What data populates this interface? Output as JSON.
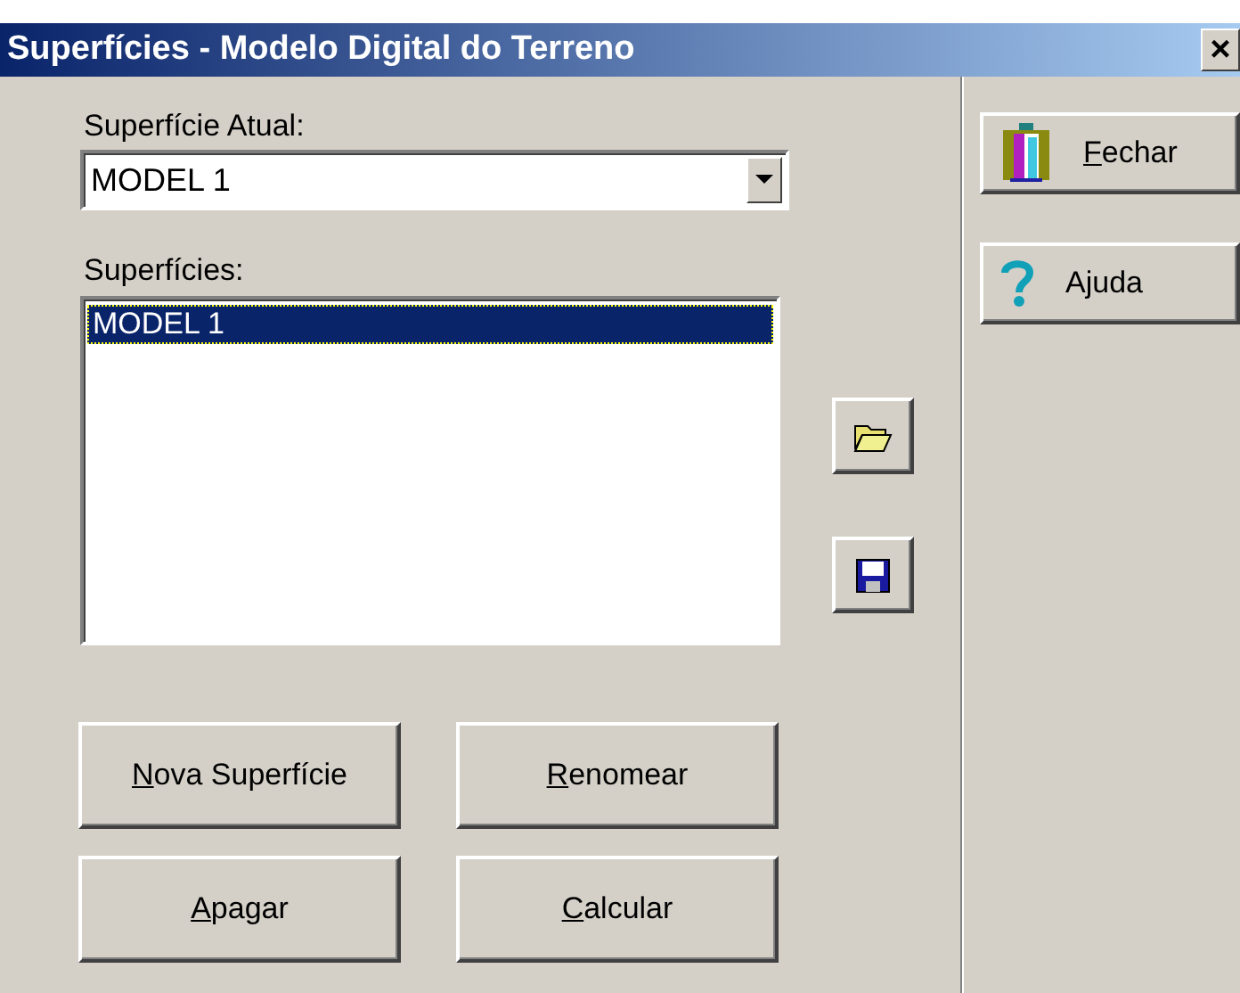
{
  "window": {
    "title": "Superfícies - Modelo Digital do Terreno",
    "close": "×"
  },
  "current_surface": {
    "label": "Superfície Atual:",
    "value": "MODEL 1"
  },
  "surfaces": {
    "label": "Superfícies:",
    "items": [
      {
        "text": "MODEL 1",
        "selected": true
      }
    ]
  },
  "side_buttons": [
    {
      "kind": "open"
    },
    {
      "kind": "save"
    }
  ],
  "buttons": [
    {
      "label": "Nova Superfície",
      "underline_first": true
    },
    {
      "label": "Renomear",
      "underline_first": true
    },
    {
      "label": "Apagar",
      "underline_first": true
    },
    {
      "label": "Calcular",
      "underline_first": true
    }
  ],
  "right_buttons": [
    {
      "kind": "exit",
      "label": "Fechar",
      "underline_first": true
    },
    {
      "kind": "help",
      "label": "Ajuda",
      "underline_first": false
    }
  ]
}
